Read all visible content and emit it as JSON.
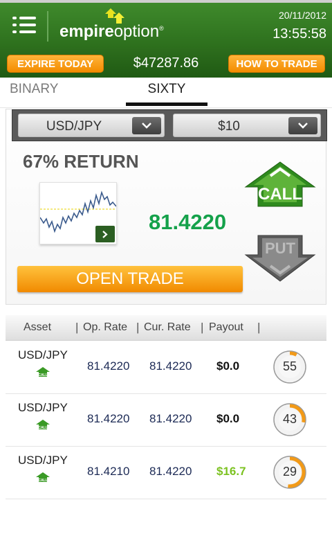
{
  "header": {
    "logo_bold": "empire",
    "logo_light": "option",
    "logo_mark": "®",
    "date": "20/11/2012",
    "time": "13:55:58"
  },
  "actionbar": {
    "expire_label": "EXPIRE TODAY",
    "balance": "$47287.86",
    "how_label": "HOW TO TRADE"
  },
  "tabs": [
    {
      "label": "BINARY",
      "active": false
    },
    {
      "label": "SIXTY",
      "active": true
    }
  ],
  "trade": {
    "asset": "USD/JPY",
    "amount": "$10",
    "return_label": "67% RETURN",
    "current_price": "81.4220",
    "call_label": "CALL",
    "put_label": "PUT",
    "open_trade_label": "OPEN TRADE"
  },
  "table": {
    "headers": [
      "Asset",
      "Op. Rate",
      "Cur. Rate",
      "Payout"
    ],
    "rows": [
      {
        "asset": "USD/JPY",
        "direction": "CALL",
        "op_rate": "81.4220",
        "cur_rate": "81.4220",
        "payout": "$0.0",
        "timer": "55",
        "payout_color": "#111111",
        "timer_fraction": 0.08
      },
      {
        "asset": "USD/JPY",
        "direction": "CALL",
        "op_rate": "81.4220",
        "cur_rate": "81.4220",
        "payout": "$0.0",
        "timer": "43",
        "payout_color": "#111111",
        "timer_fraction": 0.28
      },
      {
        "asset": "USD/JPY",
        "direction": "CALL",
        "op_rate": "81.4210",
        "cur_rate": "81.4220",
        "payout": "$16.7",
        "timer": "29",
        "payout_color": "#7cc221",
        "timer_fraction": 0.52
      }
    ]
  },
  "colors": {
    "brand_green": "#2c6e1c",
    "accent_orange": "#f38c00",
    "price_green": "#14a14a"
  }
}
